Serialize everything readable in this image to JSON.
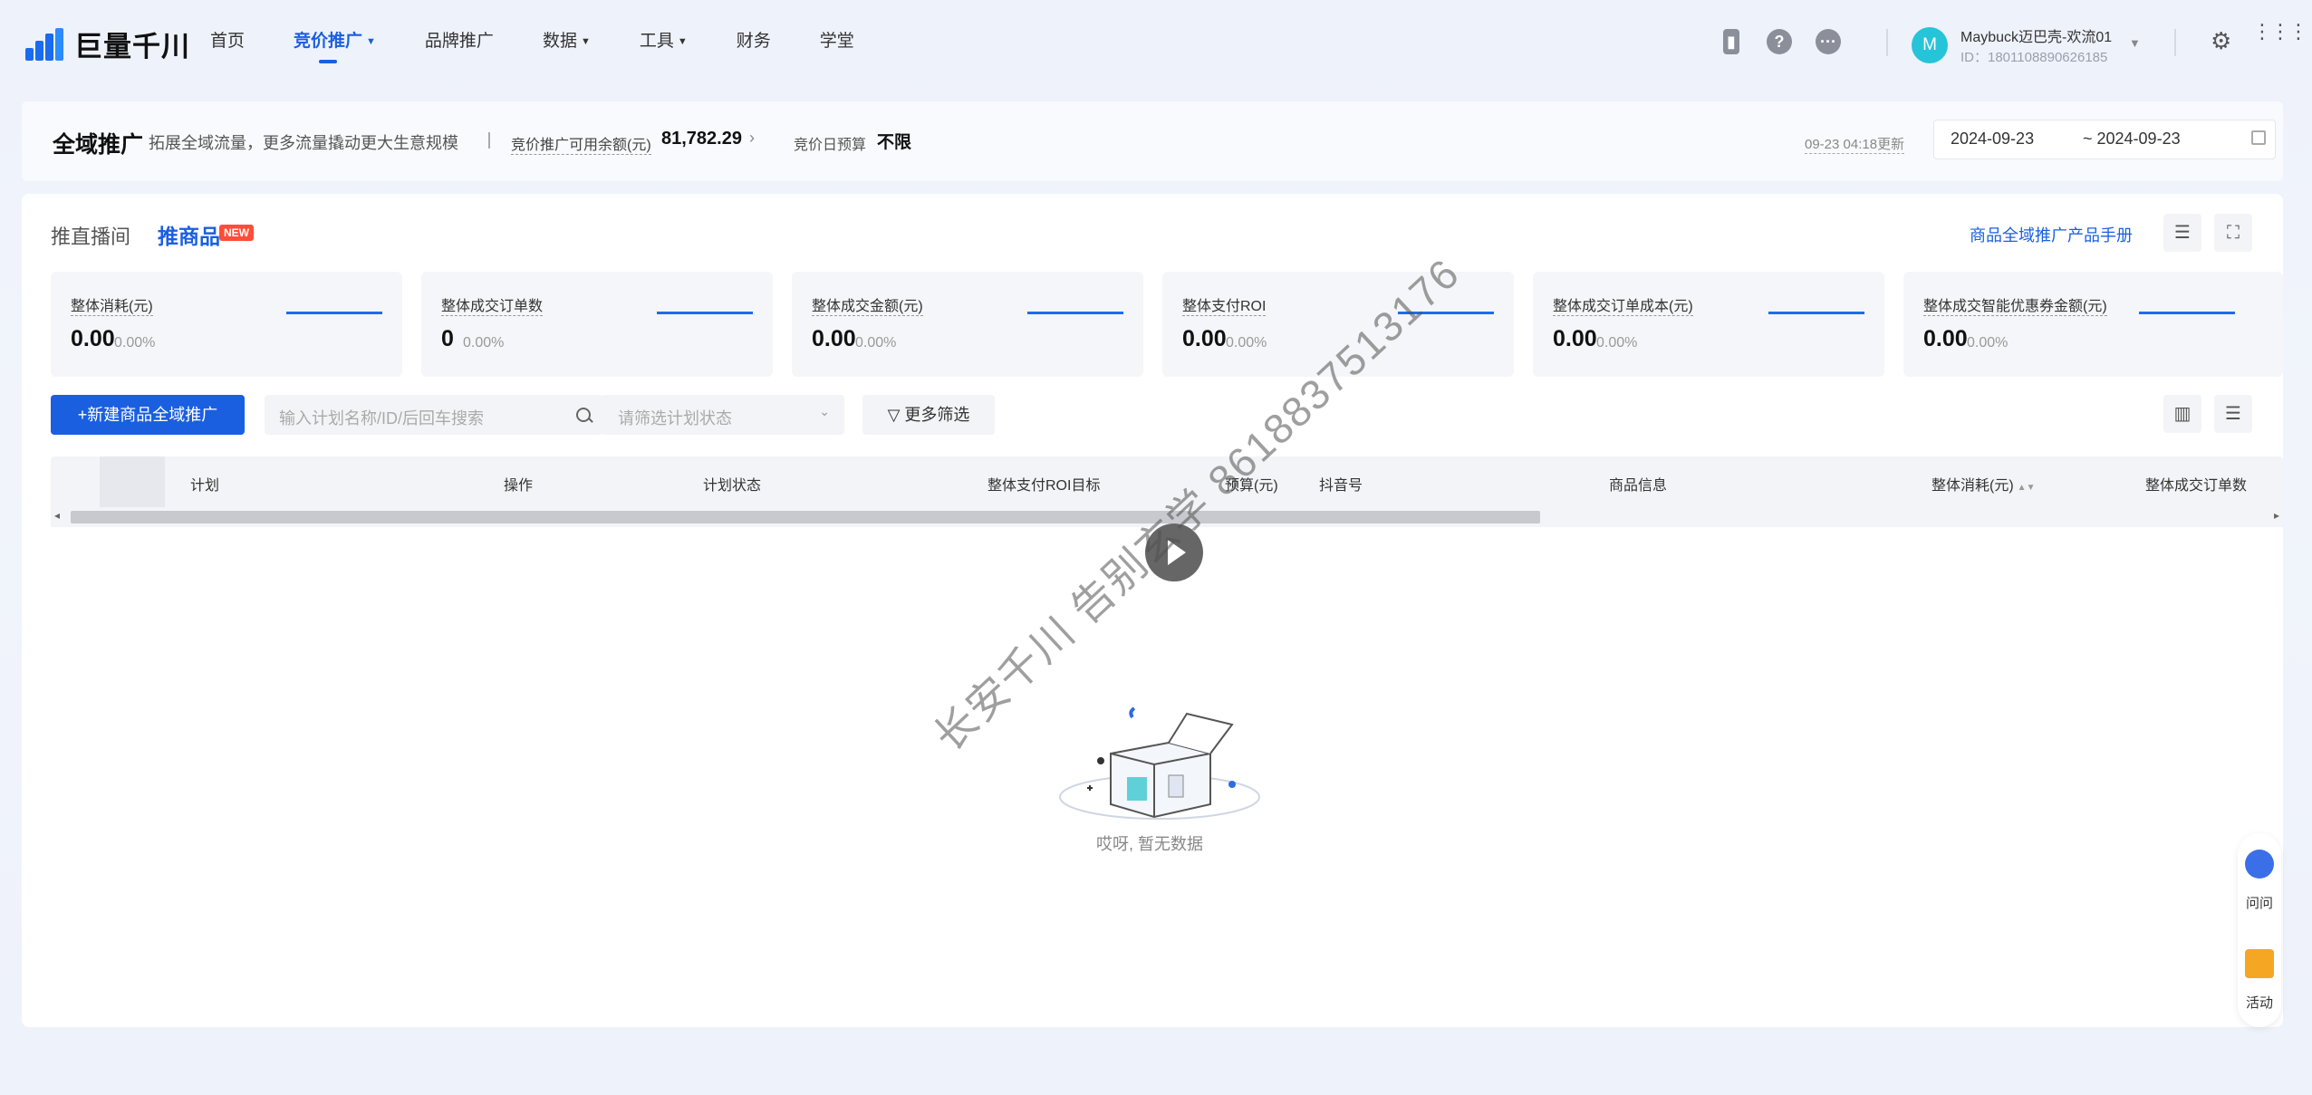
{
  "brand": {
    "name": "巨量千川"
  },
  "nav": {
    "items": [
      {
        "label": "首页"
      },
      {
        "label": "竞价推广"
      },
      {
        "label": "品牌推广"
      },
      {
        "label": "数据"
      },
      {
        "label": "工具"
      },
      {
        "label": "财务"
      },
      {
        "label": "学堂"
      }
    ],
    "active": "竞价推广"
  },
  "account": {
    "initial": "M",
    "name": "Maybuck迈巴壳-欢流01",
    "id": "ID：1801108890626185"
  },
  "header": {
    "title": "全域推广",
    "subtitle": "拓展全域流量，更多流量撬动更大生意规模",
    "balance_label": "竞价推广可用余额(元)",
    "balance": "81,782.29",
    "budget_label": "竞价日预算",
    "budget": "不限",
    "updated": "09-23 04:18更新",
    "date_start": "2024-09-23",
    "date_end": "~ 2024-09-23"
  },
  "tabs": {
    "live": "推直播间",
    "goods": "推商品",
    "badge": "NEW"
  },
  "manual_link": "商品全域推广产品手册",
  "kpis": [
    {
      "label": "整体消耗(元)",
      "value": "0.00",
      "pct": "0.00%"
    },
    {
      "label": "整体成交订单数",
      "value": "0",
      "pct": "0.00%"
    },
    {
      "label": "整体成交金额(元)",
      "value": "0.00",
      "pct": "0.00%"
    },
    {
      "label": "整体支付ROI",
      "value": "0.00",
      "pct": "0.00%"
    },
    {
      "label": "整体成交订单成本(元)",
      "value": "0.00",
      "pct": "0.00%"
    },
    {
      "label": "整体成交智能优惠券金额(元)",
      "value": "0.00",
      "pct": "0.00%"
    }
  ],
  "toolbar": {
    "new_button": "+新建商品全域推广",
    "search_placeholder": "输入计划名称/ID/后回车搜索",
    "status_placeholder": "请筛选计划状态",
    "more_filter": "更多筛选"
  },
  "table": {
    "columns": [
      "计划",
      "操作",
      "计划状态",
      "整体支付ROI目标",
      "预算(元)",
      "抖音号",
      "商品信息",
      "整体消耗(元)",
      "整体成交订单数"
    ]
  },
  "empty_text": "哎呀, 暂无数据",
  "watermark": "长安千川 告别玄学 8618837513176",
  "float": {
    "ask": "问问",
    "activity": "活动"
  },
  "colors": {
    "primary": "#1a5fe0",
    "badge": "#ff4d3a",
    "avatar": "#26c4d8"
  }
}
